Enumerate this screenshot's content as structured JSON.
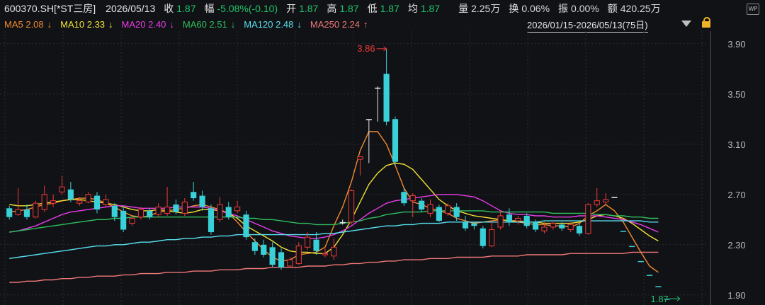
{
  "header": {
    "symbol": "600370.SH[*ST三房]",
    "date": "2026/05/13",
    "close_label": "收",
    "close_value": "1.87",
    "change_label": "幅",
    "change_value": "-5.08%(-0.10)",
    "open_label": "开",
    "open_value": "1.87",
    "high_label": "高",
    "high_value": "1.87",
    "low_label": "低",
    "low_value": "1.87",
    "avg_label": "均",
    "avg_value": "1.87",
    "volume_label": "量",
    "volume_value": "2.25万",
    "turnover_label": "换",
    "turnover_value": "0.06%",
    "amplitude_label": "振",
    "amplitude_value": "0.00%",
    "amount_label": "额",
    "amount_value": "420.25万",
    "badge": "WP"
  },
  "ma_legend": [
    {
      "label": "MA5 2.08",
      "arrow": "↓",
      "color": "#f08a30"
    },
    {
      "label": "MA10 2.33",
      "arrow": "↓",
      "color": "#f2e234"
    },
    {
      "label": "MA20 2.40",
      "arrow": "↓",
      "color": "#e83ce8"
    },
    {
      "label": "MA60 2.51",
      "arrow": "↓",
      "color": "#2fbf5f"
    },
    {
      "label": "MA120 2.48",
      "arrow": "↓",
      "color": "#58e0f0"
    },
    {
      "label": "MA250 2.24",
      "arrow": "↑",
      "color": "#f07878"
    }
  ],
  "range_label": "2026/01/15-2026/05/13(75日)",
  "colors": {
    "up": "#f03a3a",
    "down": "#3ad0d8",
    "flat": "#e6e6e6",
    "axis_text": "#b8b8b8",
    "grid": "#2a2b30"
  },
  "chart_data": {
    "type": "candlestick",
    "ylim": [
      1.82,
      4.0
    ],
    "yticks": [
      "3.90",
      "3.50",
      "3.10",
      "2.70",
      "2.30",
      "1.90"
    ],
    "ytick_values": [
      3.9,
      3.5,
      3.1,
      2.7,
      2.3,
      1.9
    ],
    "high_annotation": "3.86",
    "low_annotation": "1.87",
    "candles": [
      [
        2.59,
        2.52,
        2.61,
        2.5
      ],
      [
        2.54,
        2.58,
        2.75,
        2.53
      ],
      [
        2.58,
        2.52,
        2.62,
        2.5
      ],
      [
        2.52,
        2.63,
        2.65,
        2.51
      ],
      [
        2.58,
        2.7,
        2.77,
        2.56
      ],
      [
        2.63,
        2.65,
        2.7,
        2.6
      ],
      [
        2.72,
        2.76,
        2.85,
        2.7
      ],
      [
        2.74,
        2.66,
        2.8,
        2.64
      ],
      [
        2.63,
        2.65,
        2.68,
        2.61
      ],
      [
        2.64,
        2.7,
        2.72,
        2.63
      ],
      [
        2.69,
        2.58,
        2.72,
        2.55
      ],
      [
        2.62,
        2.66,
        2.7,
        2.6
      ],
      [
        2.61,
        2.52,
        2.63,
        2.49
      ],
      [
        2.57,
        2.42,
        2.6,
        2.4
      ],
      [
        2.47,
        2.51,
        2.53,
        2.45
      ],
      [
        2.52,
        2.58,
        2.6,
        2.5
      ],
      [
        2.57,
        2.52,
        2.59,
        2.5
      ],
      [
        2.54,
        2.6,
        2.63,
        2.52
      ],
      [
        2.55,
        2.6,
        2.76,
        2.53
      ],
      [
        2.62,
        2.56,
        2.66,
        2.54
      ],
      [
        2.55,
        2.64,
        2.67,
        2.53
      ],
      [
        2.72,
        2.67,
        2.8,
        2.65
      ],
      [
        2.69,
        2.6,
        2.73,
        2.57
      ],
      [
        2.59,
        2.4,
        2.62,
        2.38
      ],
      [
        2.5,
        2.62,
        2.68,
        2.48
      ],
      [
        2.6,
        2.52,
        2.64,
        2.5
      ],
      [
        2.57,
        2.6,
        2.65,
        2.55
      ],
      [
        2.54,
        2.36,
        2.57,
        2.34
      ],
      [
        2.32,
        2.25,
        2.35,
        2.22
      ],
      [
        2.3,
        2.22,
        2.34,
        2.2
      ],
      [
        2.28,
        2.14,
        2.32,
        2.12
      ],
      [
        2.24,
        2.12,
        2.27,
        2.1
      ],
      [
        2.13,
        2.18,
        2.2,
        2.12
      ],
      [
        2.15,
        2.29,
        2.32,
        2.14
      ],
      [
        2.28,
        2.36,
        2.4,
        2.26
      ],
      [
        2.34,
        2.25,
        2.4,
        2.22
      ],
      [
        2.22,
        2.23,
        2.27,
        2.2
      ],
      [
        2.21,
        2.28,
        2.35,
        2.18
      ],
      [
        2.48,
        2.48,
        2.5,
        2.46
      ],
      [
        2.48,
        2.73,
        2.74,
        2.46
      ],
      [
        2.98,
        3.0,
        3.0,
        2.85
      ],
      [
        3.3,
        3.3,
        3.3,
        2.95
      ],
      [
        3.55,
        3.55,
        3.56,
        3.28
      ],
      [
        3.66,
        3.28,
        3.86,
        3.25
      ],
      [
        3.3,
        2.96,
        3.32,
        2.93
      ],
      [
        2.72,
        2.63,
        2.75,
        2.61
      ],
      [
        2.65,
        2.69,
        2.71,
        2.52
      ],
      [
        2.65,
        2.58,
        2.67,
        2.56
      ],
      [
        2.55,
        2.62,
        2.66,
        2.52
      ],
      [
        2.6,
        2.49,
        2.62,
        2.48
      ],
      [
        2.55,
        2.61,
        2.63,
        2.53
      ],
      [
        2.6,
        2.52,
        2.63,
        2.49
      ],
      [
        2.48,
        2.43,
        2.53,
        2.41
      ],
      [
        2.47,
        2.45,
        2.48,
        2.42
      ],
      [
        2.43,
        2.29,
        2.45,
        2.27
      ],
      [
        2.29,
        2.42,
        2.48,
        2.28
      ],
      [
        2.44,
        2.53,
        2.57,
        2.42
      ],
      [
        2.54,
        2.48,
        2.59,
        2.45
      ],
      [
        2.49,
        2.51,
        2.53,
        2.46
      ],
      [
        2.53,
        2.45,
        2.55,
        2.43
      ],
      [
        2.48,
        2.42,
        2.5,
        2.4
      ],
      [
        2.41,
        2.44,
        2.48,
        2.39
      ],
      [
        2.44,
        2.47,
        2.48,
        2.42
      ],
      [
        2.46,
        2.43,
        2.48,
        2.41
      ],
      [
        2.42,
        2.46,
        2.48,
        2.4
      ],
      [
        2.45,
        2.39,
        2.47,
        2.37
      ],
      [
        2.39,
        2.62,
        2.63,
        2.38
      ],
      [
        2.62,
        2.65,
        2.75,
        2.6
      ],
      [
        2.64,
        2.66,
        2.71,
        2.62
      ],
      [
        2.68,
        2.68,
        2.68,
        2.68
      ],
      [
        2.41,
        2.41,
        2.41,
        2.41
      ],
      [
        2.29,
        2.29,
        2.29,
        2.29
      ],
      [
        2.17,
        2.17,
        2.17,
        2.17
      ],
      [
        2.06,
        2.06,
        2.06,
        2.06
      ],
      [
        1.97,
        1.97,
        1.97,
        1.97
      ],
      [
        1.87,
        1.87,
        1.87,
        1.87
      ]
    ],
    "ma_series": [
      {
        "name": "MA5",
        "color": "#f08a30",
        "values": [
          2.56,
          2.57,
          2.58,
          2.6,
          2.62,
          2.63,
          2.65,
          2.66,
          2.67,
          2.67,
          2.66,
          2.63,
          2.6,
          2.56,
          2.53,
          2.52,
          2.53,
          2.56,
          2.57,
          2.58,
          2.59,
          2.61,
          2.62,
          2.6,
          2.58,
          2.55,
          2.48,
          2.4,
          2.33,
          2.26,
          2.2,
          2.17,
          2.18,
          2.22,
          2.23,
          2.24,
          2.28,
          2.45,
          2.6,
          2.8,
          3.05,
          3.2,
          3.2,
          3.1,
          2.93,
          2.75,
          2.64,
          2.62,
          2.59,
          2.57,
          2.55,
          2.51,
          2.49,
          2.47,
          2.48,
          2.49,
          2.5,
          2.49,
          2.48,
          2.47,
          2.46,
          2.46,
          2.45,
          2.45,
          2.44,
          2.47,
          2.53,
          2.57,
          2.62,
          2.57,
          2.48,
          2.36,
          2.24,
          2.13,
          2.08
        ]
      },
      {
        "name": "MA10",
        "color": "#f2e234",
        "values": [
          2.62,
          2.61,
          2.61,
          2.62,
          2.63,
          2.64,
          2.65,
          2.66,
          2.66,
          2.65,
          2.64,
          2.63,
          2.62,
          2.6,
          2.58,
          2.57,
          2.57,
          2.58,
          2.57,
          2.56,
          2.55,
          2.56,
          2.58,
          2.58,
          2.57,
          2.55,
          2.51,
          2.45,
          2.41,
          2.37,
          2.33,
          2.28,
          2.25,
          2.24,
          2.24,
          2.23,
          2.23,
          2.28,
          2.38,
          2.5,
          2.64,
          2.78,
          2.87,
          2.93,
          2.95,
          2.94,
          2.9,
          2.82,
          2.74,
          2.66,
          2.61,
          2.57,
          2.55,
          2.53,
          2.52,
          2.51,
          2.5,
          2.49,
          2.49,
          2.48,
          2.48,
          2.47,
          2.47,
          2.47,
          2.47,
          2.48,
          2.5,
          2.53,
          2.54,
          2.53,
          2.51,
          2.47,
          2.42,
          2.37,
          2.33
        ]
      },
      {
        "name": "MA20",
        "color": "#e83ce8",
        "values": [
          2.4,
          2.41,
          2.43,
          2.45,
          2.48,
          2.51,
          2.54,
          2.56,
          2.57,
          2.58,
          2.59,
          2.6,
          2.61,
          2.61,
          2.6,
          2.59,
          2.59,
          2.59,
          2.59,
          2.6,
          2.6,
          2.6,
          2.6,
          2.59,
          2.57,
          2.55,
          2.53,
          2.5,
          2.47,
          2.44,
          2.41,
          2.39,
          2.37,
          2.36,
          2.35,
          2.35,
          2.36,
          2.38,
          2.41,
          2.45,
          2.5,
          2.55,
          2.59,
          2.63,
          2.65,
          2.66,
          2.67,
          2.68,
          2.69,
          2.7,
          2.7,
          2.7,
          2.69,
          2.68,
          2.65,
          2.61,
          2.57,
          2.55,
          2.54,
          2.54,
          2.53,
          2.53,
          2.52,
          2.52,
          2.52,
          2.53,
          2.53,
          2.53,
          2.52,
          2.51,
          2.5,
          2.48,
          2.46,
          2.43,
          2.4
        ]
      },
      {
        "name": "MA60",
        "color": "#2fbf5f",
        "values": [
          2.4,
          2.41,
          2.42,
          2.43,
          2.44,
          2.45,
          2.46,
          2.47,
          2.48,
          2.49,
          2.5,
          2.5,
          2.51,
          2.51,
          2.52,
          2.52,
          2.52,
          2.52,
          2.52,
          2.52,
          2.52,
          2.52,
          2.52,
          2.52,
          2.52,
          2.52,
          2.52,
          2.51,
          2.51,
          2.5,
          2.5,
          2.49,
          2.48,
          2.47,
          2.47,
          2.46,
          2.46,
          2.46,
          2.47,
          2.48,
          2.49,
          2.51,
          2.52,
          2.54,
          2.55,
          2.56,
          2.56,
          2.56,
          2.57,
          2.57,
          2.57,
          2.57,
          2.57,
          2.57,
          2.57,
          2.56,
          2.56,
          2.56,
          2.56,
          2.56,
          2.56,
          2.56,
          2.55,
          2.55,
          2.55,
          2.55,
          2.55,
          2.54,
          2.54,
          2.53,
          2.53,
          2.52,
          2.52,
          2.51,
          2.51
        ]
      },
      {
        "name": "MA120",
        "color": "#58e0f0",
        "values": [
          2.19,
          2.2,
          2.21,
          2.22,
          2.23,
          2.24,
          2.25,
          2.26,
          2.27,
          2.28,
          2.29,
          2.29,
          2.3,
          2.3,
          2.31,
          2.32,
          2.32,
          2.33,
          2.34,
          2.34,
          2.35,
          2.35,
          2.36,
          2.36,
          2.37,
          2.37,
          2.38,
          2.38,
          2.38,
          2.38,
          2.38,
          2.38,
          2.38,
          2.38,
          2.38,
          2.38,
          2.39,
          2.39,
          2.4,
          2.41,
          2.42,
          2.43,
          2.44,
          2.45,
          2.45,
          2.46,
          2.46,
          2.47,
          2.47,
          2.47,
          2.48,
          2.48,
          2.48,
          2.48,
          2.48,
          2.48,
          2.48,
          2.48,
          2.48,
          2.48,
          2.48,
          2.49,
          2.49,
          2.49,
          2.49,
          2.49,
          2.49,
          2.49,
          2.49,
          2.49,
          2.49,
          2.49,
          2.49,
          2.48,
          2.48
        ]
      },
      {
        "name": "MA250",
        "color": "#f07878",
        "values": [
          2.0,
          2.0,
          2.01,
          2.01,
          2.02,
          2.02,
          2.03,
          2.03,
          2.04,
          2.04,
          2.05,
          2.05,
          2.05,
          2.06,
          2.06,
          2.07,
          2.07,
          2.07,
          2.08,
          2.08,
          2.08,
          2.09,
          2.09,
          2.09,
          2.1,
          2.1,
          2.1,
          2.11,
          2.11,
          2.11,
          2.12,
          2.12,
          2.12,
          2.12,
          2.13,
          2.13,
          2.13,
          2.14,
          2.14,
          2.15,
          2.15,
          2.16,
          2.16,
          2.17,
          2.17,
          2.18,
          2.18,
          2.18,
          2.19,
          2.19,
          2.19,
          2.2,
          2.2,
          2.2,
          2.2,
          2.21,
          2.21,
          2.21,
          2.21,
          2.22,
          2.22,
          2.22,
          2.22,
          2.22,
          2.23,
          2.23,
          2.23,
          2.23,
          2.23,
          2.23,
          2.23,
          2.24,
          2.24,
          2.24,
          2.24
        ]
      }
    ]
  }
}
